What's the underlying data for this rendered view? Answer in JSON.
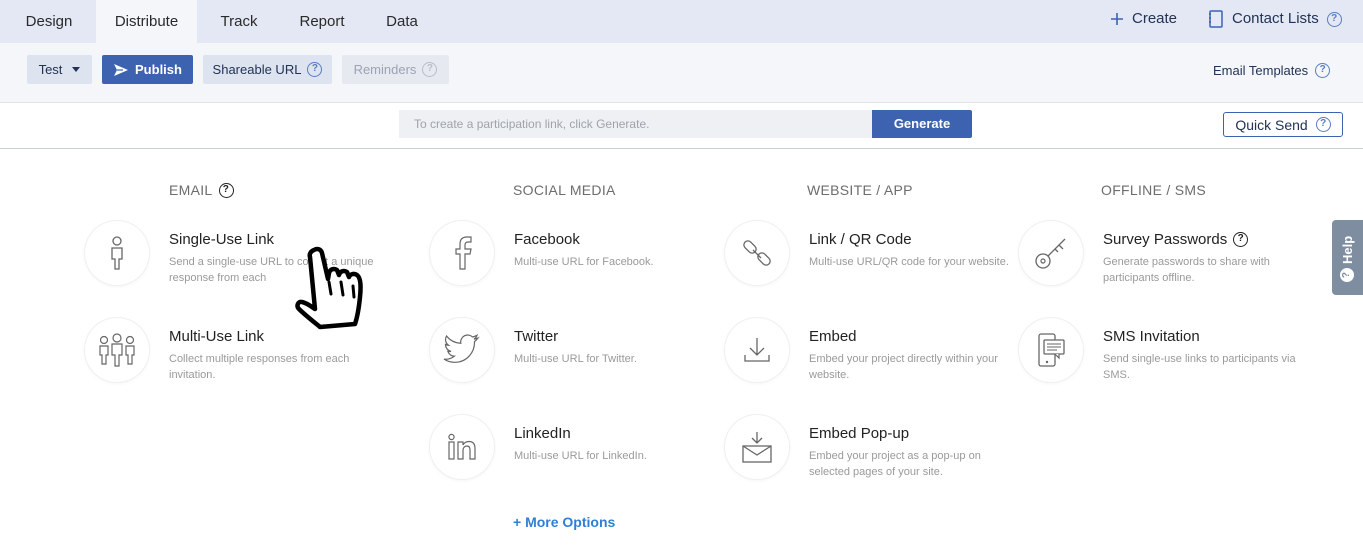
{
  "tabs": [
    {
      "label": "Design"
    },
    {
      "label": "Distribute"
    },
    {
      "label": "Track"
    },
    {
      "label": "Report"
    },
    {
      "label": "Data"
    }
  ],
  "top_right": {
    "create_label": "Create",
    "contact_lists_label": "Contact Lists"
  },
  "actionbar": {
    "test_label": "Test",
    "publish_label": "Publish",
    "shareable_url_label": "Shareable URL",
    "reminders_label": "Reminders",
    "email_templates_label": "Email Templates"
  },
  "generate": {
    "placeholder": "To create a participation link, click Generate.",
    "button_label": "Generate",
    "quick_send_label": "Quick Send"
  },
  "columns": {
    "email": {
      "heading": "EMAIL",
      "items": [
        {
          "title": "Single-Use Link",
          "desc": "Send a single-use URL to collect a unique response from each",
          "icon": "person-icon"
        },
        {
          "title": "Multi-Use Link",
          "desc": "Collect multiple responses from each invitation.",
          "icon": "group-icon"
        }
      ]
    },
    "social": {
      "heading": "SOCIAL MEDIA",
      "items": [
        {
          "title": "Facebook",
          "desc": "Multi-use URL for Facebook.",
          "icon": "facebook-icon"
        },
        {
          "title": "Twitter",
          "desc": "Multi-use URL for Twitter.",
          "icon": "twitter-icon"
        },
        {
          "title": "LinkedIn",
          "desc": "Multi-use URL for LinkedIn.",
          "icon": "linkedin-icon"
        }
      ],
      "more_label": "+ More Options"
    },
    "website": {
      "heading": "WEBSITE / APP",
      "items": [
        {
          "title": "Link / QR Code",
          "desc": "Multi-use URL/QR code for your website.",
          "icon": "link-icon"
        },
        {
          "title": "Embed",
          "desc": "Embed your project directly within your website.",
          "icon": "download-icon"
        },
        {
          "title": "Embed Pop-up",
          "desc": "Embed your project as a pop-up on selected pages of your site.",
          "icon": "envelope-download-icon"
        }
      ]
    },
    "offline": {
      "heading": "OFFLINE / SMS",
      "items": [
        {
          "title": "Survey Passwords",
          "desc": "Generate passwords to share with participants offline.",
          "icon": "key-icon"
        },
        {
          "title": "SMS Invitation",
          "desc": "Send single-use links to participants via SMS.",
          "icon": "phone-message-icon"
        }
      ]
    }
  },
  "help_label": "Help",
  "colors": {
    "primary": "#3d63b0",
    "topbar": "#e3e8f4",
    "link": "#2f7fd8"
  }
}
